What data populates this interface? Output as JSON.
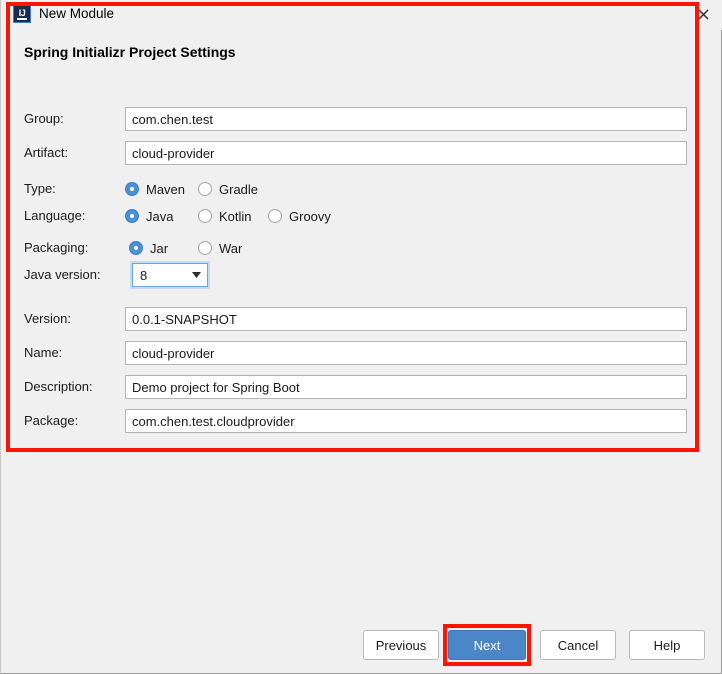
{
  "window": {
    "title": "New Module",
    "icon": "intellij-idea-icon",
    "close_icon": "close-icon"
  },
  "panel": {
    "heading": "Spring Initializr Project Settings",
    "fields": [
      {
        "label": "Group:",
        "value": "com.chen.test"
      },
      {
        "label": "Artifact:",
        "value": "cloud-provider"
      }
    ],
    "type_row": {
      "label": "Type:",
      "options": [
        {
          "label": "Maven",
          "selected": true
        },
        {
          "label": "Gradle",
          "selected": false
        }
      ]
    },
    "language_row": {
      "label": "Language:",
      "options": [
        {
          "label": "Java",
          "selected": true
        },
        {
          "label": "Kotlin",
          "selected": false
        },
        {
          "label": "Groovy",
          "selected": false
        }
      ]
    },
    "packaging_row": {
      "label": "Packaging:",
      "options": [
        {
          "label": "Jar",
          "selected": true
        },
        {
          "label": "War",
          "selected": false
        }
      ]
    },
    "java_version_row": {
      "label": "Java version:",
      "value": "8",
      "arrow_icon": "chevron-down-icon"
    },
    "fields2": [
      {
        "label": "Version:",
        "value": "0.0.1-SNAPSHOT"
      },
      {
        "label": "Name:",
        "value": "cloud-provider"
      },
      {
        "label": "Description:",
        "value": "Demo project for Spring Boot"
      },
      {
        "label": "Package:",
        "value": "com.chen.test.cloudprovider"
      }
    ]
  },
  "buttons": {
    "previous": "Previous",
    "next": "Next",
    "cancel": "Cancel",
    "help": "Help"
  },
  "colors": {
    "annotation": "#fb1505",
    "primary_button": "#4a86c8",
    "radio_selected": "#4a90d9",
    "focus_ring": "#6ba7de",
    "window_bg": "#f0f0f0"
  }
}
